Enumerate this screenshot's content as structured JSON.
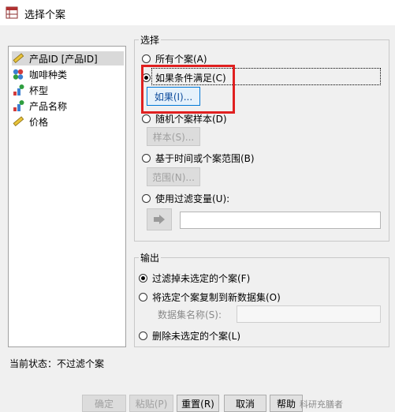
{
  "window": {
    "title": "选择个案"
  },
  "variables": [
    {
      "label": "产品ID [产品ID]",
      "icon": "scale-ruler-icon",
      "selected": true
    },
    {
      "label": "咖啡种类",
      "icon": "nominal-variable-icon",
      "selected": false
    },
    {
      "label": "杯型",
      "icon": "ordinal-variable-icon",
      "selected": false
    },
    {
      "label": "产品名称",
      "icon": "ordinal-variable-icon",
      "selected": false
    },
    {
      "label": "价格",
      "icon": "scale-ruler-icon",
      "selected": false
    }
  ],
  "select_group": {
    "legend": "选择",
    "all_cases": "所有个案(A)",
    "if_condition": "如果条件满足(C)",
    "if_button": "如果(I)...",
    "random_sample": "随机个案样本(D)",
    "sample_button": "样本(S)...",
    "time_range": "基于时间或个案范围(B)",
    "range_button": "范围(N)...",
    "filter_variable": "使用过滤变量(U):"
  },
  "output_group": {
    "legend": "输出",
    "filter_out": "过滤掉未选定的个案(F)",
    "copy_to_dataset": "将选定个案复制到新数据集(O)",
    "dataset_name_label": "数据集名称(S):",
    "delete_unselected": "删除未选定的个案(L)"
  },
  "status_text": "当前状态：不过滤个案",
  "footer": {
    "ok": "确定",
    "paste": "粘贴(P)",
    "reset": "重置(R)",
    "cancel": "取消",
    "help": "帮助"
  },
  "watermark": "科研充膳者",
  "colors": {
    "highlight": "#e02020",
    "accent": "#0078d7"
  }
}
